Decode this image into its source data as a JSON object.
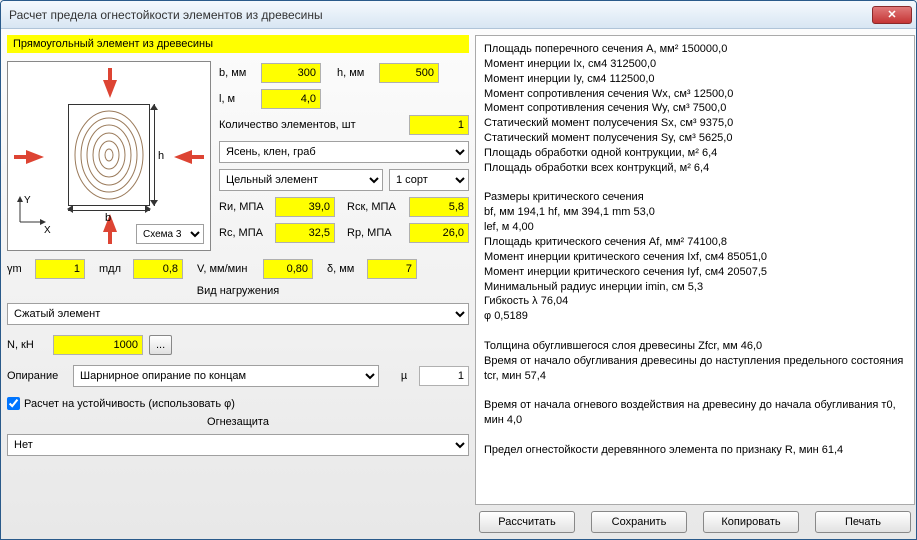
{
  "window": {
    "title": "Расчет предела огнестойкости элементов из древесины"
  },
  "header": "Прямоугольный элемент из древесины",
  "dims": {
    "b_lbl": "b, мм",
    "b": "300",
    "h_lbl": "h, мм",
    "h": "500",
    "l_lbl": "l, м",
    "l": "4,0",
    "qty_lbl": "Количество элементов, шт",
    "qty": "1"
  },
  "scheme_lbl": "Схема 3",
  "wood_species": "Ясень, клен, граб",
  "element_type": "Цельный элемент",
  "grade": "1 сорт",
  "strength": {
    "Ri_lbl": "Rи, МПА",
    "Ri": "39,0",
    "Rck_lbl": "Rск, МПА",
    "Rck": "5,8",
    "Rc_lbl": "Rс, МПА",
    "Rc": "32,5",
    "Rp_lbl": "Rр, МПА",
    "Rp": "26,0"
  },
  "coefs": {
    "ym_lbl": "γm",
    "ym": "1",
    "mdl_lbl": "mдл",
    "mdl": "0,8",
    "V_lbl": "V, мм/мин",
    "V": "0,80",
    "delta_lbl": "δ, мм",
    "delta": "7"
  },
  "load_header": "Вид нагружения",
  "load_type": "Сжатый элемент",
  "N_lbl": "N, кН",
  "N": "1000",
  "N_btn": "...",
  "support_lbl": "Опирание",
  "support": "Шарнирное опирание по концам",
  "mu_lbl": "µ",
  "mu": "1",
  "stability_chk": "Расчет на устойчивость (использовать φ)",
  "fireprotection_header": "Огнезащита",
  "fireprotection": "Нет",
  "buttons": {
    "calc": "Рассчитать",
    "save": "Сохранить",
    "copy": "Копировать",
    "print": "Печать"
  },
  "diagram": {
    "b_dim": "b",
    "h_dim": "h",
    "axisY": "Y",
    "axisX": "X"
  },
  "results": [
    "Площадь поперечного сечения A, мм²   150000,0",
    "Момент инерции Ix, см4   312500,0",
    "Момент инерции Iy, см4   112500,0",
    "Момент сопротивления сечения Wx, см³   12500,0",
    "Момент сопротивления сечения Wy, см³   7500,0",
    "Статический момент полусечения Sx, см³   9375,0",
    "Статический момент полусечения Sy, см³   5625,0",
    "Площадь обработки одной контрукции, м²   6,4",
    "Площадь обработки всех контрукций, м²   6,4",
    "",
    "Размеры критического сечения",
    "bf, мм  194,1  hf, мм   394,1  mm  53,0",
    "lef, м   4,00",
    "Площадь критического сечения Af, мм²   74100,8",
    "Момент инерции критического сечения Ixf, см4   85051,0",
    "Момент инерции критического сечения Iyf, см4   20507,5",
    "Минимальный радиус инерции imin, см    5,3",
    "Гибкость λ 76,04",
    "φ  0,5189",
    "",
    "Толщина обуглившегося слоя древесины Zfcr, мм   46,0",
    "Время от начало обугливания  древесины до наступления предельного состояния tcr, мин   57,4",
    "",
    "Время от начала огневого воздействия на древесину до начала обугливания т0, мин  4,0",
    "",
    "Предел огнестойкости деревянного элемента по признаку R, мин  61,4"
  ]
}
